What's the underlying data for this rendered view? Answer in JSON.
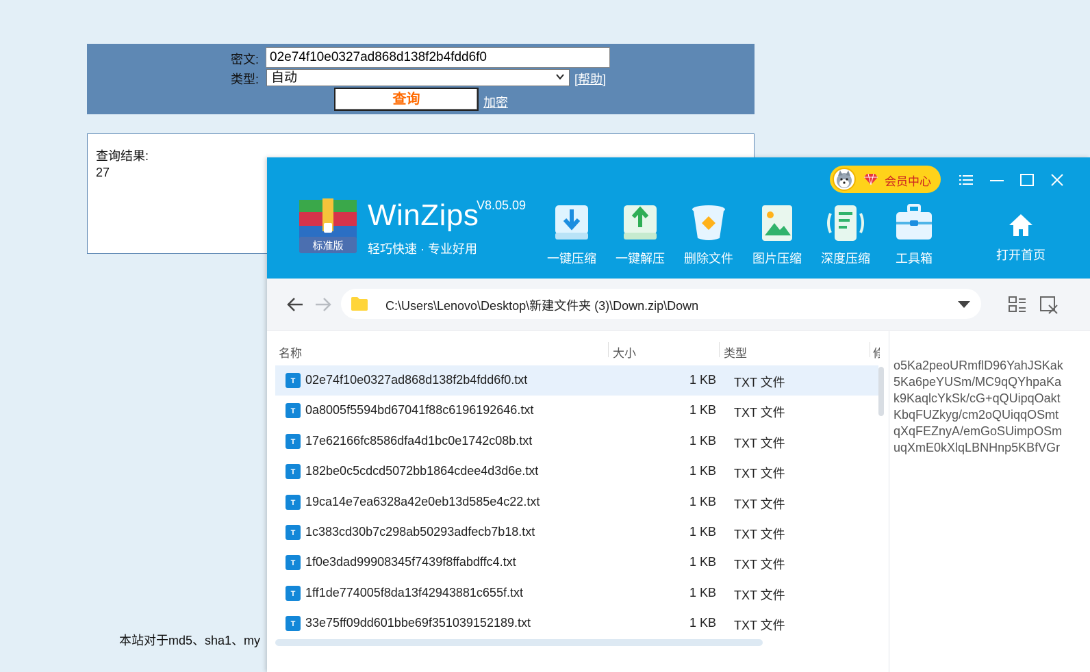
{
  "query_form": {
    "cipher_label": "密文:",
    "cipher_value": "02e74f10e0327ad868d138f2b4fdd6f0",
    "type_label": "类型:",
    "type_value": "自动",
    "help_link": "[帮助]",
    "query_button": "查询",
    "encrypt_link": "加密"
  },
  "result": {
    "label": "查询结果:",
    "value": "27"
  },
  "footer_note": "本站对于md5、sha1、my",
  "winzips": {
    "app_name": "WinZips",
    "version": "V8.05.09",
    "slogan": "轻巧快速 · 专业好用",
    "logo_badge": "标准版",
    "vip_label": "会员中心",
    "toolbar": [
      {
        "id": "one-click-compress",
        "label": "一键压缩",
        "icon": "compress-icon"
      },
      {
        "id": "one-click-extract",
        "label": "一键解压",
        "icon": "extract-icon"
      },
      {
        "id": "delete-file",
        "label": "删除文件",
        "icon": "trash-icon"
      },
      {
        "id": "image-compress",
        "label": "图片压缩",
        "icon": "image-icon"
      },
      {
        "id": "deep-compress",
        "label": "深度压缩",
        "icon": "deep-compress-icon"
      },
      {
        "id": "toolbox",
        "label": "工具箱",
        "icon": "toolbox-icon"
      }
    ],
    "home_label": "打开首页",
    "address": "C:\\Users\\Lenovo\\Desktop\\新建文件夹 (3)\\Down.zip\\Down",
    "columns": {
      "name": "名称",
      "size": "大小",
      "type": "类型",
      "extra": "修"
    },
    "files": [
      {
        "name": "02e74f10e0327ad868d138f2b4fdd6f0.txt",
        "size": "1 KB",
        "type": "TXT 文件",
        "selected": true
      },
      {
        "name": "0a8005f5594bd67041f88c6196192646.txt",
        "size": "1 KB",
        "type": "TXT 文件"
      },
      {
        "name": "17e62166fc8586dfa4d1bc0e1742c08b.txt",
        "size": "1 KB",
        "type": "TXT 文件"
      },
      {
        "name": "182be0c5cdcd5072bb1864cdee4d3d6e.txt",
        "size": "1 KB",
        "type": "TXT 文件"
      },
      {
        "name": "19ca14e7ea6328a42e0eb13d585e4c22.txt",
        "size": "1 KB",
        "type": "TXT 文件"
      },
      {
        "name": "1c383cd30b7c298ab50293adfecb7b18.txt",
        "size": "1 KB",
        "type": "TXT 文件"
      },
      {
        "name": "1f0e3dad99908345f7439f8ffabdffc4.txt",
        "size": "1 KB",
        "type": "TXT 文件"
      },
      {
        "name": "1ff1de774005f8da13f42943881c655f.txt",
        "size": "1 KB",
        "type": "TXT 文件"
      },
      {
        "name": "33e75ff09dd601bbe69f351039152189.txt",
        "size": "1 KB",
        "type": "TXT 文件"
      }
    ],
    "file_icon_letter": "T",
    "preview_lines": [
      "o5Ka2peoURmflD96YahJSKak",
      "5Ka6peYUSm/MC9qQYhpaKa",
      "k9KaqlcYkSk/cG+qQUipqOakt",
      "KbqFUZkyg/cm2oQUiqqOSmt",
      "qXqFEZnyA/emGoSUimpOSm",
      "uqXmE0kXlqLBNHnp5KBfVGr"
    ]
  }
}
